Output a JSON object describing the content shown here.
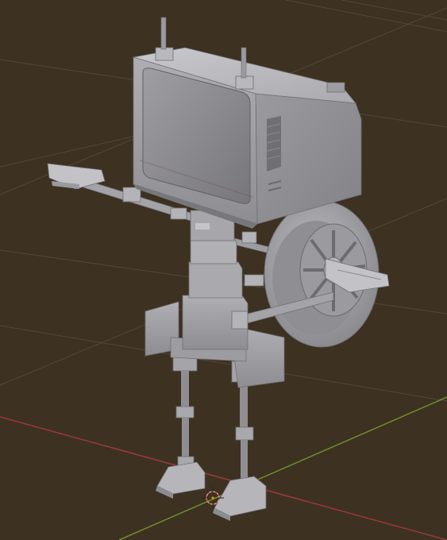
{
  "viewport": {
    "background_color": "#3d3121",
    "grid_line_color": "#53473a",
    "x_axis_color": "#9a3a3a",
    "y_axis_color": "#6f8f2c",
    "model_color": "#a6a6ab"
  },
  "scene": {
    "model": "robot-tv-head",
    "parts": [
      "crt-monitor-head",
      "antenna-left",
      "antenna-right",
      "neck",
      "torso",
      "left-arm",
      "right-arm",
      "left-hand",
      "right-hand",
      "wheel",
      "hips",
      "left-leg",
      "right-leg",
      "left-foot",
      "right-foot"
    ],
    "origin_marker": "3d-cursor"
  }
}
